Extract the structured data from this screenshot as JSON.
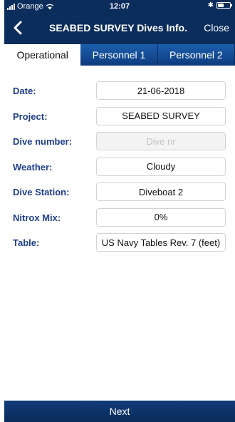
{
  "status": {
    "carrier": "Orange",
    "time": "12:07"
  },
  "nav": {
    "title": "SEABED SURVEY Dives Info.",
    "close_label": "Close"
  },
  "tabs": [
    {
      "label": "Operational",
      "active": true
    },
    {
      "label": "Personnel 1",
      "active": false
    },
    {
      "label": "Personnel 2",
      "active": false
    }
  ],
  "form": {
    "rows": [
      {
        "label": "Date:",
        "value": "21-06-2018"
      },
      {
        "label": "Project:",
        "value": "SEABED SURVEY"
      },
      {
        "label": "Dive number:",
        "value": "",
        "placeholder": "Dive nr"
      },
      {
        "label": "Weather:",
        "value": "Cloudy"
      },
      {
        "label": "Dive Station:",
        "value": "Diveboat 2"
      },
      {
        "label": "Nitrox Mix:",
        "value": "0%"
      },
      {
        "label": "Table:",
        "value": "US Navy Tables Rev. 7 (feet)"
      }
    ]
  },
  "footer": {
    "next_label": "Next"
  },
  "colors": {
    "nav_bg": "#0b2d5c",
    "tab_bg": "#1d5fae",
    "label": "#1e3e8c"
  }
}
